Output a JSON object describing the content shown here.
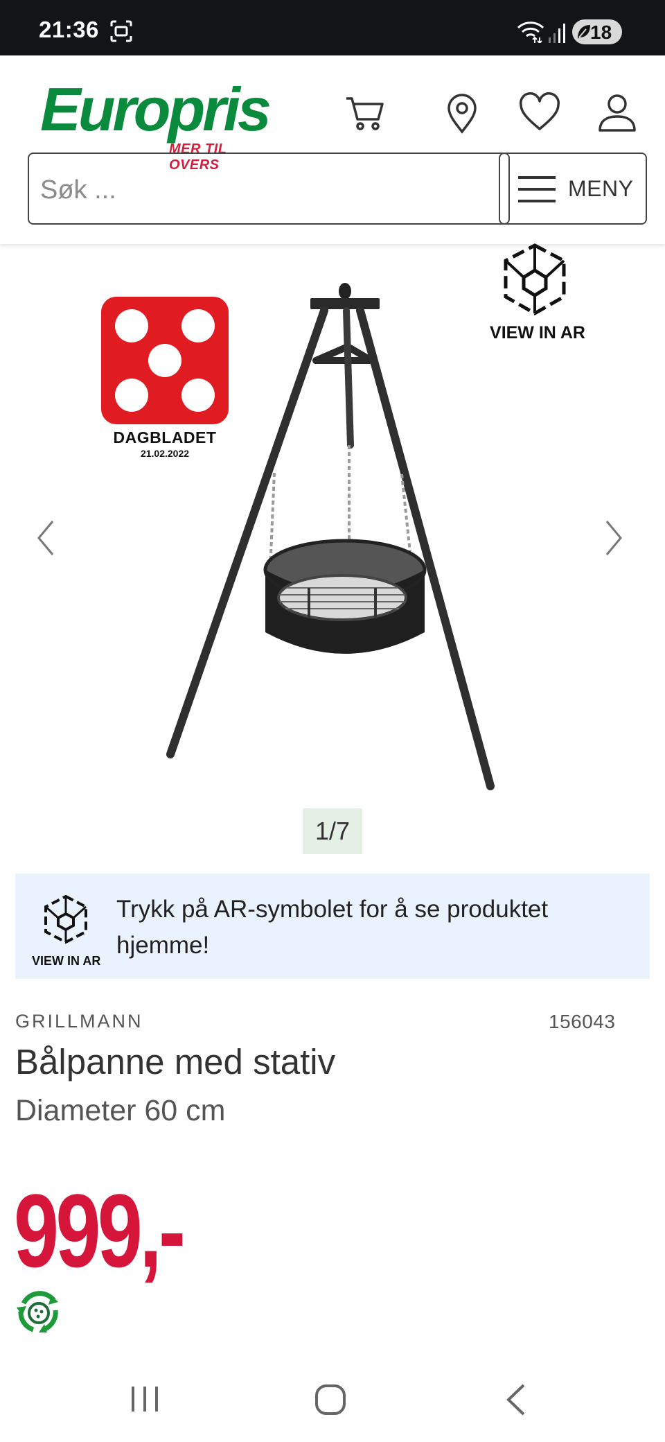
{
  "status_bar": {
    "time": "21:36",
    "battery": "18",
    "icons": [
      "screenshot-icon",
      "wifi-icon",
      "signal-icon",
      "battery-icon"
    ]
  },
  "header": {
    "logo_text": "Europris",
    "logo_tagline": "MER TIL OVERS",
    "icons": [
      "cart-icon",
      "location-icon",
      "heart-icon",
      "user-icon"
    ],
    "search_placeholder": "Søk ...",
    "menu_label": "MENY"
  },
  "gallery": {
    "badge_name": "DAGBLADET",
    "badge_date": "21.02.2022",
    "ar_label": "VIEW IN AR",
    "counter": "1/7"
  },
  "ar_banner": {
    "text": "Trykk på AR-symbolet for å se produktet hjemme!",
    "icon_label": "VIEW IN AR"
  },
  "product": {
    "brand": "GRILLMANN",
    "sku": "156043",
    "title": "Bålpanne med stativ",
    "subtitle": "Diameter 60 cm",
    "price": "999,-"
  },
  "colors": {
    "brand_green": "#0a8a3c",
    "brand_red": "#d31f3b",
    "price_red": "#d5153a",
    "badge_red": "#e11b22",
    "banner_bg": "#eaf3fd"
  }
}
